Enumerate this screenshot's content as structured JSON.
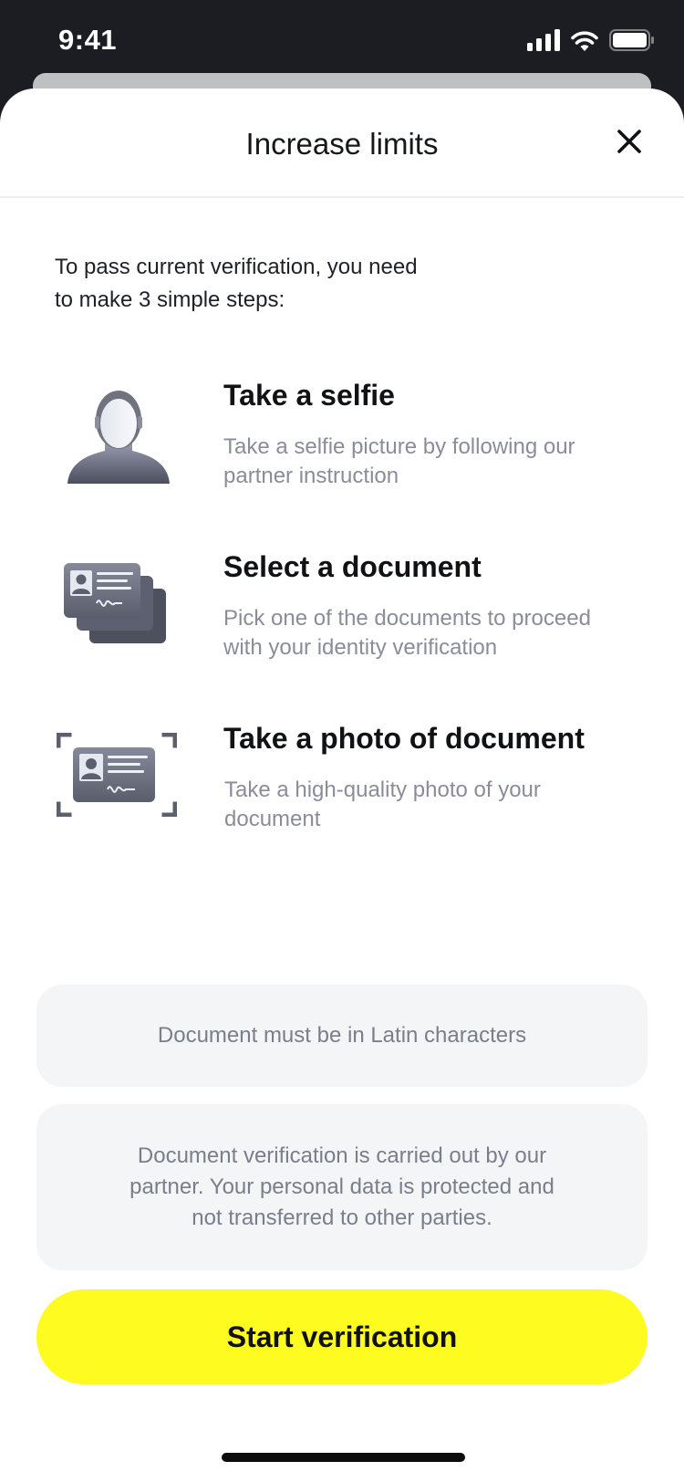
{
  "status_bar": {
    "time": "9:41",
    "icons": [
      "signal-icon",
      "wifi-icon",
      "battery-icon"
    ]
  },
  "sheet": {
    "title": "Increase limits",
    "close_icon": "close-icon"
  },
  "intro": {
    "line1": "To pass current verification, you need",
    "line2": "to make 3 simple steps:"
  },
  "steps": [
    {
      "icon": "selfie-bust-icon",
      "title": "Take a selfie",
      "desc_line1": "Take a selfie picture by following our",
      "desc_line2": "partner instruction"
    },
    {
      "icon": "document-stack-icon",
      "title": "Select a document",
      "desc_line1": "Pick one of the documents to proceed",
      "desc_line2": "with your identity verification"
    },
    {
      "icon": "document-scan-icon",
      "title": "Take a photo of document",
      "desc_line1": "Take a high-quality photo of your",
      "desc_line2": "document"
    }
  ],
  "notices": {
    "latin": "Document must be in Latin characters",
    "privacy_line1": "Document verification is carried out by our",
    "privacy_line2": "partner. Your personal data is protected and",
    "privacy_line3": "not transferred to other parties."
  },
  "cta": {
    "label": "Start verification"
  },
  "colors": {
    "accent": "#fdfb1f",
    "text_primary": "#111216",
    "text_secondary": "#8a8d99",
    "notice_bg": "#f4f5f7"
  }
}
